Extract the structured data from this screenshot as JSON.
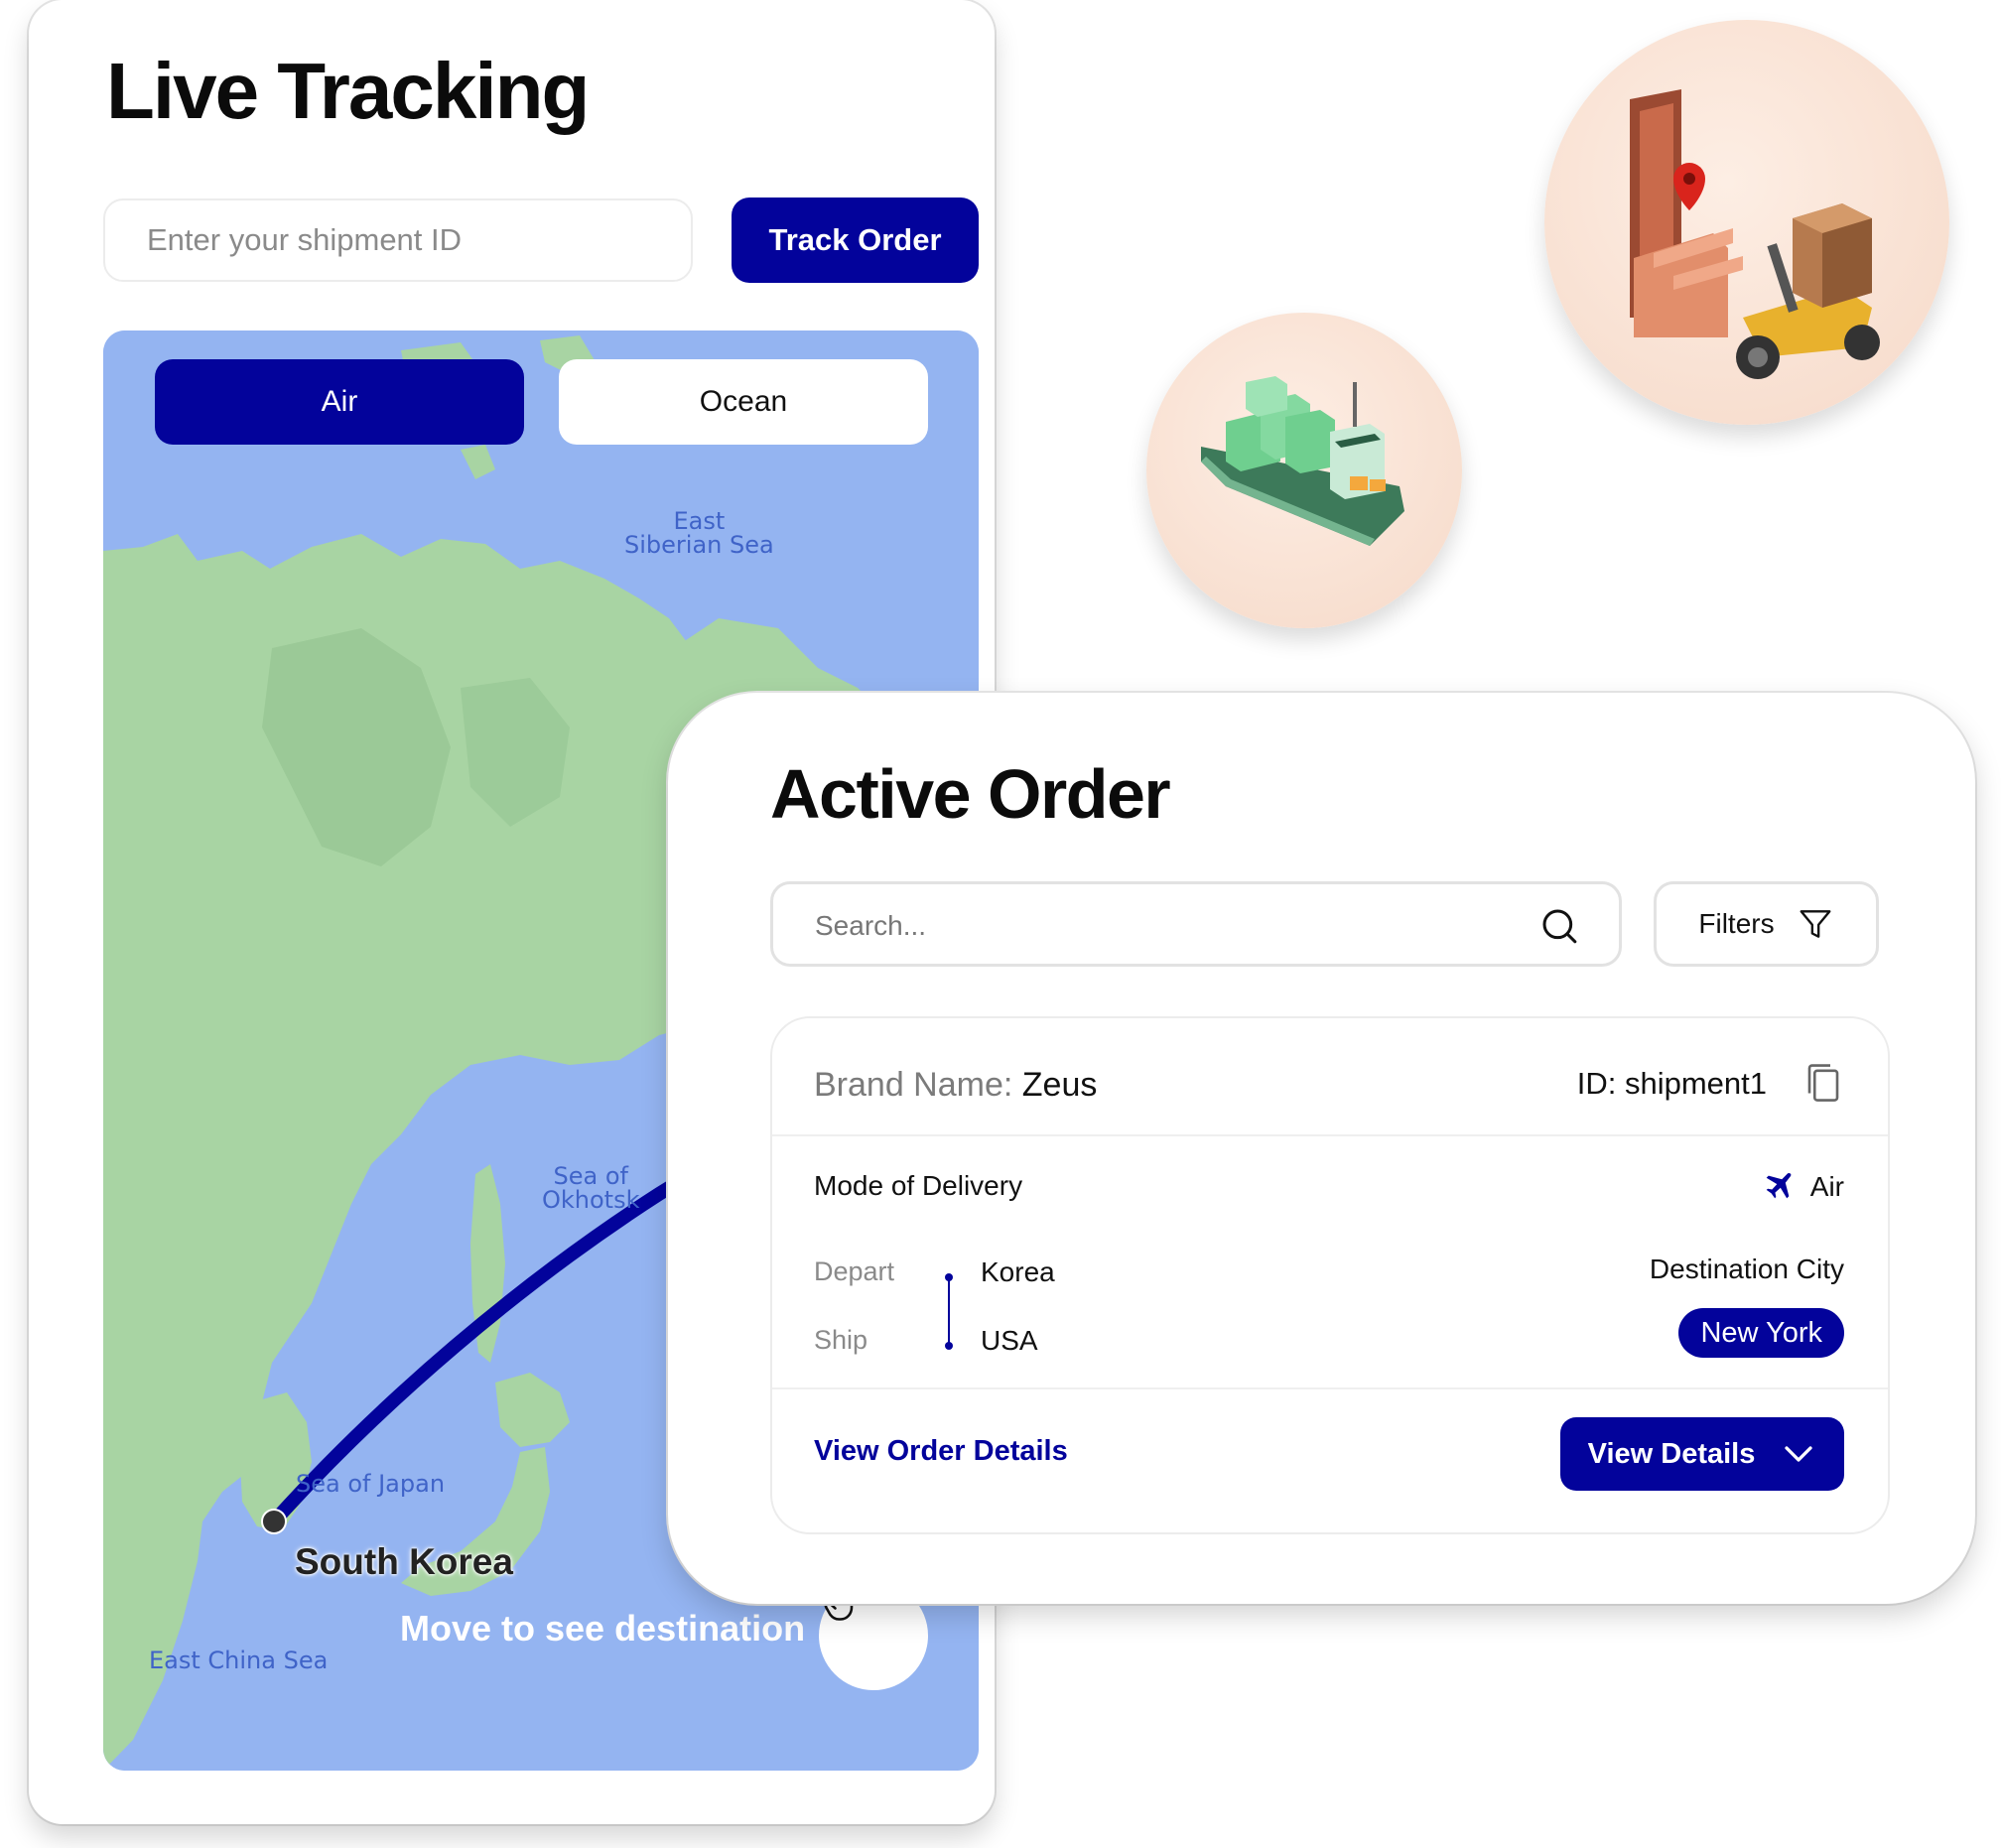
{
  "live_tracking": {
    "title": "Live Tracking",
    "shipment_input_placeholder": "Enter your shipment ID",
    "track_button": "Track Order",
    "mode_tabs": [
      {
        "label": "Air",
        "selected": true
      },
      {
        "label": "Ocean",
        "selected": false
      }
    ],
    "map": {
      "labels": {
        "east_siberian_sea": "East\nSiberian Sea",
        "sea_of_okhotsk": "Sea of\nOkhotsk",
        "sea_of_japan": "Sea of Japan",
        "east_china_sea": "East China Sea"
      },
      "origin": "South Korea",
      "hint": "Move to see destination",
      "route_color": "#03039b",
      "water_color": "#94b4f1",
      "land_color": "#a8d4a3"
    }
  },
  "active_order": {
    "title": "Active Order",
    "search_placeholder": "Search...",
    "filters_label": "Filters",
    "order": {
      "brand_label": "Brand Name:",
      "brand_value": "Zeus",
      "id_text": "ID: shipment1",
      "mode_label": "Mode of Delivery",
      "mode_value": "Air",
      "depart_label": "Depart",
      "depart_value": "Korea",
      "ship_label": "Ship",
      "ship_value": "USA",
      "destination_label": "Destination City",
      "destination_value": "New York",
      "view_order_link": "View Order Details",
      "view_details_button": "View Details"
    }
  },
  "theme": {
    "accent": "#03039b"
  },
  "icons": [
    "search-icon",
    "filter-icon",
    "copy-icon",
    "airplane-icon",
    "chevron-down-icon",
    "hand-pointer-icon",
    "cargo-ship-illustration",
    "delivery-scooter-illustration"
  ]
}
